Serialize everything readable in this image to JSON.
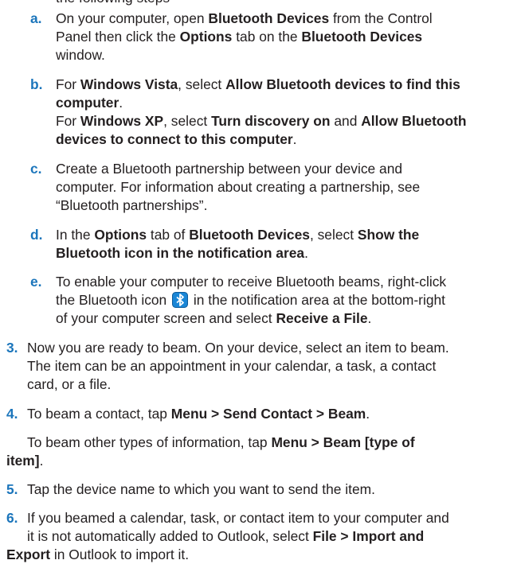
{
  "doc": {
    "top_fragment": "the following steps",
    "steps": {
      "a": {
        "label": "a.",
        "t1": "On your computer, open ",
        "b1": "Bluetooth Devices",
        "t2": " from the Control",
        "t3": "Panel then click the ",
        "b2": "Options",
        "t4": " tab on the ",
        "b3": "Bluetooth Devices",
        "t5": "window."
      },
      "b": {
        "label": "b.",
        "t1": "For ",
        "b1": "Windows Vista",
        "t2": ", select ",
        "b2": "Allow Bluetooth devices to find this",
        "b3": "computer",
        "t3": ".",
        "t4": "For ",
        "b4": "Windows XP",
        "t5": ", select ",
        "b5": "Turn discovery on",
        "t6": " and ",
        "b6": "Allow Bluetooth",
        "b7": "devices to connect to this computer",
        "t7": "."
      },
      "c": {
        "label": "c.",
        "t1": "Create a Bluetooth partnership between your device and",
        "t2": "computer. For information about creating a partnership, see",
        "t3": "“Bluetooth partnerships”."
      },
      "d": {
        "label": "d.",
        "t1": "In the ",
        "b1": "Options",
        "t2": " tab of ",
        "b2": "Bluetooth Devices",
        "t3": ", select ",
        "b3": "Show the",
        "b4": "Bluetooth icon in the notification area",
        "t4": "."
      },
      "e": {
        "label": "e.",
        "t1": "To enable your computer to receive Bluetooth beams, right-click",
        "t2": "the Bluetooth icon ",
        "t3": " in the notification area at the bottom-right",
        "t4": "of your computer screen and select ",
        "b1": "Receive a File",
        "t5": "."
      },
      "s3": {
        "label": "3.",
        "t1": "Now you are ready to beam. On your device, select an item to beam.",
        "t2": "The item can be an appointment in your calendar, a task, a contact",
        "t3": "card, or a file."
      },
      "s4": {
        "label": "4.",
        "t1": "To beam a contact, tap ",
        "b1": "Menu > Send Contact > Beam",
        "t2": ".",
        "t3": "To beam other types of information, tap ",
        "b2": "Menu > Beam [type of",
        "b3": "item]",
        "t4": "."
      },
      "s5": {
        "label": "5.",
        "t1": "Tap the device name to which you want to send the item."
      },
      "s6": {
        "label": "6.",
        "t1": "If you beamed a calendar, task, or contact item to your computer and",
        "t2": "it is not automatically added to Outlook, select ",
        "b1": "File > Import and",
        "b2": "Export",
        "t3": " in Outlook to import it."
      }
    },
    "colors": {
      "label": "#1b75bb",
      "text": "#231f20",
      "icon_bg": "#1a86d6"
    }
  }
}
